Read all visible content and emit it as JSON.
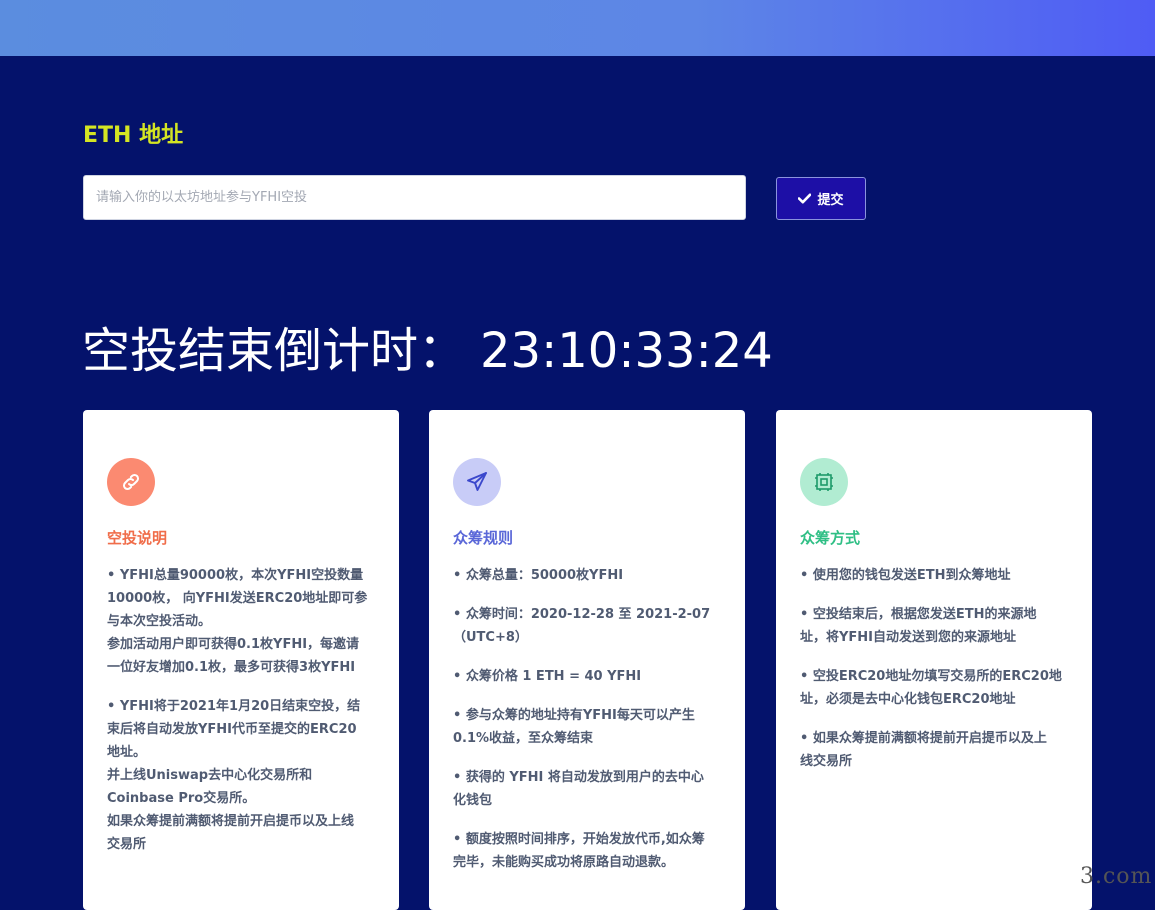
{
  "eth": {
    "label": "ETH 地址",
    "placeholder": "请输入你的以太坊地址参与YFHI空投",
    "submit_label": "提交"
  },
  "countdown": {
    "label": "空投结束倒计时：",
    "time": "23:10:33:24"
  },
  "cards": [
    {
      "icon": "link-icon",
      "title": "空投说明",
      "title_color": "#f06d4a",
      "icon_bg": "#fb8a71",
      "paragraphs": [
        [
          "• YFHI总量90000枚，本次YFHI空投数量",
          "10000枚， 向YFHI发送ERC20地址即可参",
          "与本次空投活动。",
          "参加活动用户即可获得0.1枚YFHI，每邀请",
          "一位好友增加0.1枚，最多可获得3枚YFHI"
        ],
        [
          "• YFHI将于2021年1月20日结束空投，结",
          "束后将自动发放YFHI代币至提交的ERC20",
          "地址。",
          "并上线Uniswap去中心化交易所和",
          "Coinbase Pro交易所。",
          "如果众筹提前满额将提前开启提币以及上线",
          "交易所"
        ]
      ]
    },
    {
      "icon": "paper-plane-icon",
      "title": "众筹规则",
      "title_color": "#5a67d8",
      "icon_bg": "#c8ccf7",
      "paragraphs": [
        [
          "• 众筹总量：50000枚YFHI"
        ],
        [
          "• 众筹时间：2020-12-28 至 2021-2-07",
          "（UTC+8）"
        ],
        [
          "• 众筹价格 1 ETH = 40 YFHI"
        ],
        [
          "• 参与众筹的地址持有YFHI每天可以产生",
          "0.1%收益，至众筹结束"
        ],
        [
          "• 获得的 YFHI 将自动发放到用户的去中心",
          "化钱包"
        ],
        [
          "• 额度按照时间排序，开始发放代币,如众筹",
          "完毕，未能购买成功将原路自动退款。"
        ]
      ]
    },
    {
      "icon": "chip-icon",
      "title": "众筹方式",
      "title_color": "#2fbf85",
      "icon_bg": "#b1ecd2",
      "paragraphs": [
        [
          "• 使用您的钱包发送ETH到众筹地址"
        ],
        [
          "• 空投结束后，根据您发送ETH的来源地",
          "址，将YFHI自动发送到您的来源地址"
        ],
        [
          "• 空投ERC20地址勿填写交易所的ERC20地",
          "址，必须是去中心化钱包ERC20地址"
        ],
        [
          "• 如果众筹提前满额将提前开启提币以及上",
          "线交易所"
        ]
      ]
    }
  ],
  "watermark": "3.com"
}
